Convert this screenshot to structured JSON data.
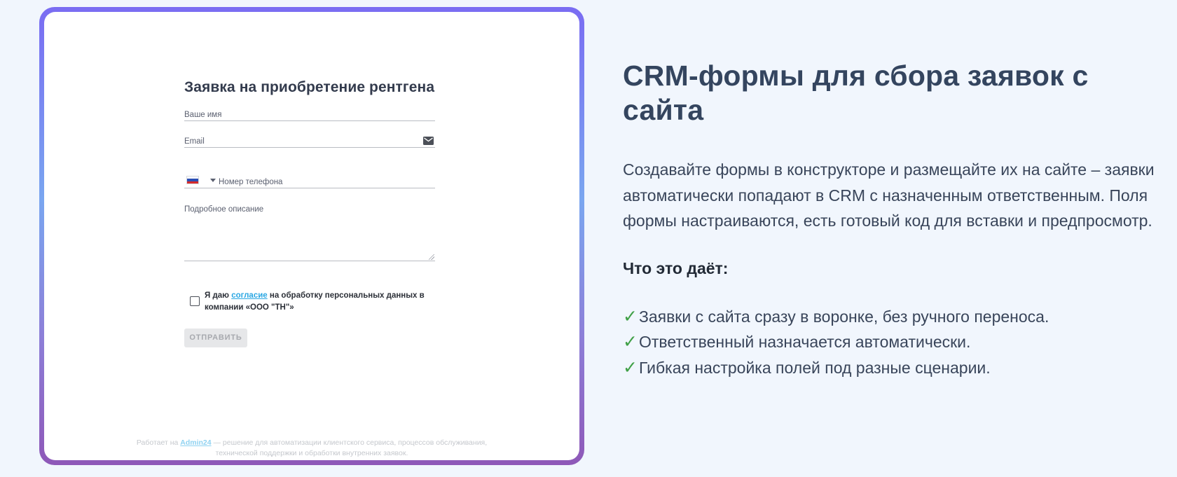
{
  "form": {
    "title": "Заявка на приобретение рентгена",
    "name_placeholder": "Ваше имя",
    "email_placeholder": "Email",
    "phone_placeholder": "Номер телефона",
    "phone_country": "RU",
    "description_placeholder": "Подробное описание",
    "consent_prefix": "Я даю ",
    "consent_link": "согласие",
    "consent_suffix": " на обработку персональных данных в компании «ООО \"ТН\"»",
    "consent_checked": false,
    "submit_label": "ОТПРАВИТЬ",
    "footer_prefix": "Работает на ",
    "footer_link": "Admin24",
    "footer_suffix_line1": " — решение для автоматизации клиентского сервиса, процессов обслуживания,",
    "footer_line2": "технической поддержки и обработки внутренних заявок."
  },
  "info": {
    "headline": "CRM-формы для сбора заявок с сайта",
    "description": "Создавайте формы в конструкторе и размещайте их на сайте – заявки автоматически попадают в CRM с назначенным ответственным. Поля формы настраиваются, есть готовый код для вставки и предпросмотр.",
    "benefits_title": "Что это даёт:",
    "benefits": [
      "Заявки с сайта сразу в воронке, без ручного переноса.",
      "Ответственный назначается автоматически.",
      "Гибкая настройка полей под разные сценарии."
    ],
    "check_mark": "✓"
  },
  "colors": {
    "background": "#f1f6fd",
    "frame_gradient": [
      "#7a6cf2",
      "#7aa6f0",
      "#8e58b8"
    ],
    "link": "#2aa7e3",
    "check": "#3fa046",
    "headline": "#34455f"
  },
  "icons": {
    "email_field": "mail-icon",
    "phone_flag": "russia-flag-icon",
    "country_dropdown": "chevron-down-icon",
    "benefit_bullet": "check-icon"
  }
}
